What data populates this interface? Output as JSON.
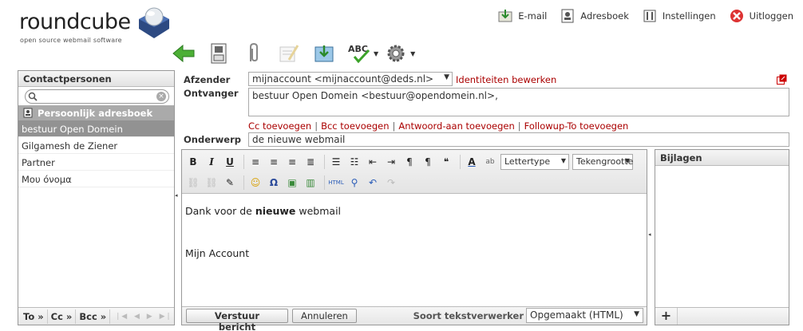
{
  "logo": {
    "name": "roundcube",
    "tagline": "open source webmail software"
  },
  "topnav": [
    {
      "label": "E-mail",
      "icon": "mail-icon"
    },
    {
      "label": "Adresboek",
      "icon": "addressbook-icon"
    },
    {
      "label": "Instellingen",
      "icon": "settings-icon"
    },
    {
      "label": "Uitloggen",
      "icon": "logout-icon"
    }
  ],
  "toolbar": [
    "back-icon",
    "save-icon",
    "attach-icon",
    "signature-icon",
    "insert-response-icon",
    "spellcheck-icon",
    "options-icon"
  ],
  "contacts": {
    "header": "Contactpersonen",
    "search_placeholder": "",
    "addressbook": "Persoonlijk adresboek",
    "items": [
      "bestuur Open Domein",
      "Gilgamesh de Ziener",
      "Partner",
      "Mου όνομα"
    ],
    "selected_index": 0,
    "footer": {
      "to": "To »",
      "cc": "Cc »",
      "bcc": "Bcc »"
    }
  },
  "compose": {
    "from_label": "Afzender",
    "from_value": "mijnaccount <mijnaccount@deds.nl>",
    "edit_identities": "Identiteiten bewerken",
    "to_label": "Ontvanger",
    "to_value": "bestuur Open Domein <bestuur@opendomein.nl>,",
    "add_cc": "Cc toevoegen",
    "add_bcc": "Bcc toevoegen",
    "add_replyto": "Antwoord-aan toevoegen",
    "add_followupto": "Followup-To toevoegen",
    "subject_label": "Onderwerp",
    "subject_value": "de nieuwe webmail"
  },
  "editor": {
    "font_family": "Lettertype",
    "font_size": "Tekengrootte",
    "body_line1_pre": "Dank voor de ",
    "body_line1_bold": "nieuwe",
    "body_line1_post": " webmail",
    "body_line2": "Mijn Account",
    "send": "Verstuur bericht",
    "cancel": "Annuleren",
    "editor_type_label": "Soort tekstverwerker",
    "editor_type_value": "Opgemaakt (HTML)"
  },
  "attachments": {
    "header": "Bijlagen",
    "add": "+"
  },
  "colors": {
    "link_red": "#aa0000",
    "selected_bg": "#929292",
    "green_arrow": "#3c9a2a"
  }
}
